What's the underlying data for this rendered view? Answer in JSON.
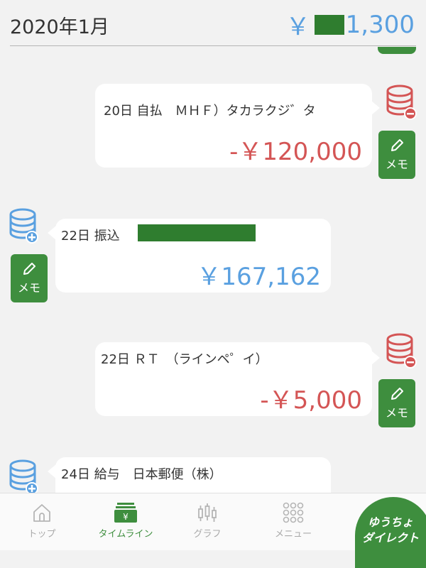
{
  "header": {
    "month": "2020年1月",
    "balance_prefix": "￥",
    "balance_suffix": "1,300"
  },
  "entries": [
    {
      "day": "20日",
      "description": "20日 自払　ＭＨＦ）タカラクジ゛タ",
      "amount": "-￥120,000",
      "type": "withdrawal",
      "memo": "メモ"
    },
    {
      "day": "22日",
      "description": "22日 振込",
      "amount": "￥167,162",
      "type": "deposit",
      "memo": "メモ"
    },
    {
      "day": "22日",
      "description": "22日 ＲＴ　（ラインペ゜イ）",
      "amount": "-￥5,000",
      "type": "withdrawal",
      "memo": "メモ"
    },
    {
      "day": "24日",
      "description": "24日 給与　日本郵便（株）",
      "type": "deposit"
    }
  ],
  "tabs": [
    {
      "label": "トップ",
      "icon": "home-icon"
    },
    {
      "label": "タイムライン",
      "icon": "timeline-icon",
      "active": true
    },
    {
      "label": "グラフ",
      "icon": "graph-icon"
    },
    {
      "label": "メニュー",
      "icon": "menu-grid-icon"
    }
  ],
  "direct_button": {
    "line1": "ゆうちょ",
    "line2": "ダイレクト"
  },
  "colors": {
    "green": "#3e8e3e",
    "withdrawal_red": "#d45555",
    "deposit_blue": "#5aa0e0",
    "background": "#f2f2f2"
  }
}
